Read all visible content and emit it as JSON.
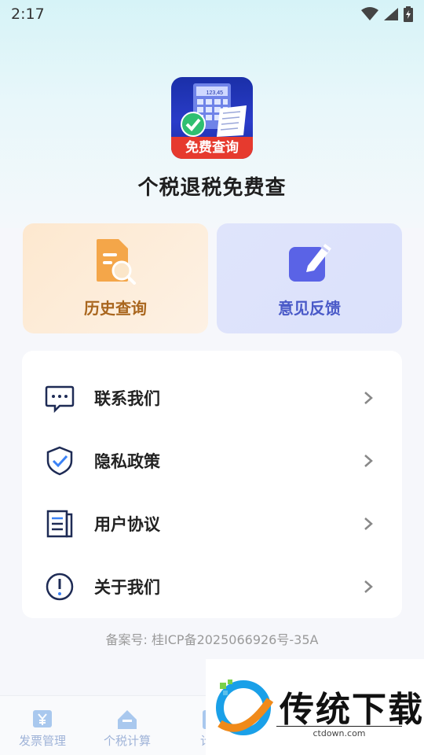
{
  "status_bar": {
    "time": "2:17"
  },
  "app": {
    "title": "个税退税免费查",
    "icon_badge": "免费查询",
    "icon_number": "123,45"
  },
  "cards": [
    {
      "label": "历史查询",
      "icon": "document-search-icon"
    },
    {
      "label": "意见反馈",
      "icon": "edit-icon"
    }
  ],
  "menu": {
    "items": [
      {
        "label": "联系我们",
        "icon": "chat-bubble-icon"
      },
      {
        "label": "隐私政策",
        "icon": "shield-check-icon"
      },
      {
        "label": "用户协议",
        "icon": "document-list-icon"
      },
      {
        "label": "关于我们",
        "icon": "info-circle-icon"
      }
    ]
  },
  "footer": {
    "icp": "备案号: 桂ICP备2025066926号-35A"
  },
  "tabbar": {
    "tabs": [
      {
        "label": "发票管理",
        "icon": "yen-invoice-icon"
      },
      {
        "label": "个税计算",
        "icon": "calculator-icon"
      },
      {
        "label": "计算",
        "icon": "calc-icon"
      }
    ]
  },
  "watermark": {
    "text": "传统下载",
    "url": "ctdown.com"
  },
  "colors": {
    "accent": "#4a5ac8",
    "history": "#a9661e",
    "menu_icon": "#1e3a8a"
  }
}
